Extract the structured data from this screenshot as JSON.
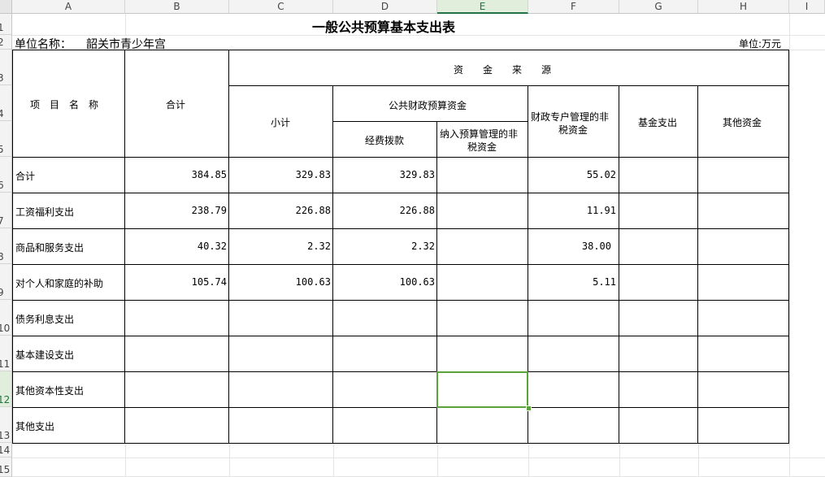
{
  "columns": [
    "A",
    "B",
    "C",
    "D",
    "E",
    "F",
    "G",
    "H",
    "I"
  ],
  "rows": [
    "1",
    "2",
    "3",
    "4",
    "5",
    "6",
    "7",
    "8",
    "9",
    "10",
    "11",
    "12",
    "13",
    "14",
    "15"
  ],
  "title": "一般公共预算基本支出表",
  "unit_name_label": "单位名称：",
  "unit_name_value": "韶关市青少年宫",
  "unit_label": "单位:万元",
  "headers": {
    "item_name": "项　目　名　称",
    "total": "合计",
    "funding_source": "资　　金　　来　　源",
    "subtotal": "小计",
    "public_budget": "公共财政预算资金",
    "appropriation": "经费拨款",
    "non_tax_line1": "纳入预算管理的非",
    "non_tax_line2": "税资金",
    "special_line1": "财政专户管理的非",
    "special_line2": "税资金",
    "fund_expense": "基金支出",
    "other_fund": "其他资金"
  },
  "table_rows": [
    {
      "name": "合计",
      "total": "384.85",
      "subtotal": "329.83",
      "appropriation": "329.83",
      "non_tax": "",
      "special": "55.02",
      "fund": "",
      "other": ""
    },
    {
      "name": "工资福利支出",
      "total": "238.79",
      "subtotal": "226.88",
      "appropriation": "226.88",
      "non_tax": "",
      "special": "11.91",
      "fund": "",
      "other": ""
    },
    {
      "name": "商品和服务支出",
      "total": "40.32",
      "subtotal": "2.32",
      "appropriation": "2.32",
      "non_tax": "",
      "special": "38.00",
      "fund": "",
      "other": ""
    },
    {
      "name": "对个人和家庭的补助",
      "total": "105.74",
      "subtotal": "100.63",
      "appropriation": "100.63",
      "non_tax": "",
      "special": "5.11",
      "fund": "",
      "other": ""
    },
    {
      "name": "债务利息支出",
      "total": "",
      "subtotal": "",
      "appropriation": "",
      "non_tax": "",
      "special": "",
      "fund": "",
      "other": ""
    },
    {
      "name": "基本建设支出",
      "total": "",
      "subtotal": "",
      "appropriation": "",
      "non_tax": "",
      "special": "",
      "fund": "",
      "other": ""
    },
    {
      "name": "其他资本性支出",
      "total": "",
      "subtotal": "",
      "appropriation": "",
      "non_tax": "",
      "special": "",
      "fund": "",
      "other": ""
    },
    {
      "name": "其他支出",
      "total": "",
      "subtotal": "",
      "appropriation": "",
      "non_tax": "",
      "special": "",
      "fund": "",
      "other": ""
    }
  ],
  "selected_column": "E",
  "selected_row": "12"
}
